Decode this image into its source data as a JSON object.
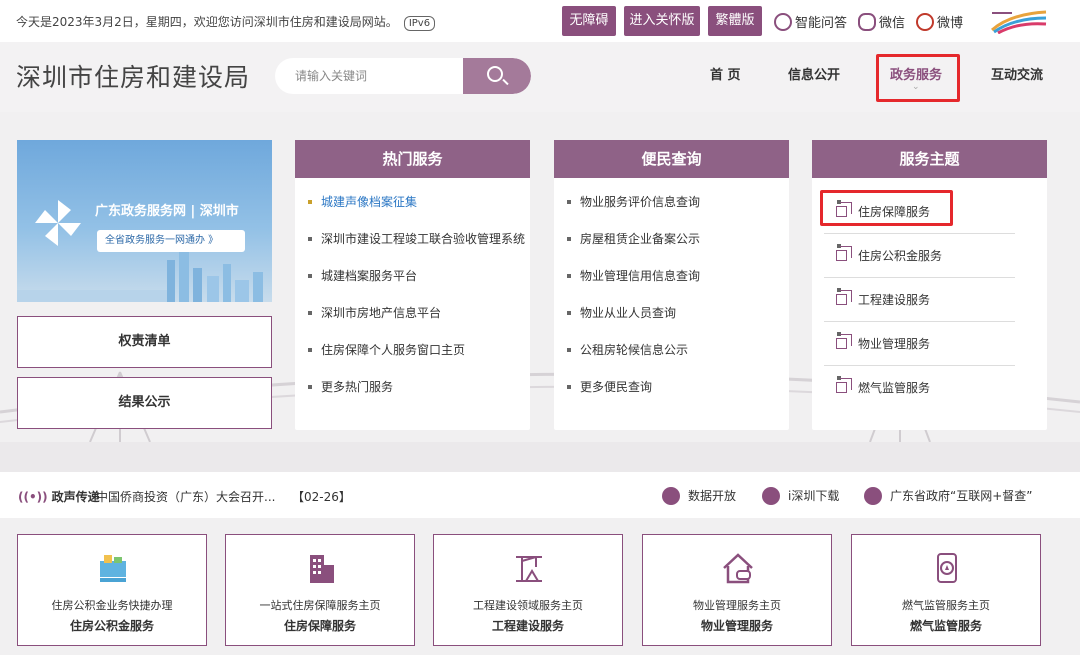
{
  "topbar": {
    "date_text": "今天是2023年3月2日，星期四，欢迎您访问深圳市住房和建设局网站。",
    "ipv6": "IPv6",
    "buttons": [
      "无障碍",
      "进入关怀版",
      "繁體版"
    ],
    "links": [
      "智能问答",
      "微信",
      "微博"
    ]
  },
  "header": {
    "site_title": "深圳市住房和建设局",
    "search_placeholder": "请输入关键词",
    "nav": [
      "首 页",
      "信息公开",
      "政务服务",
      "互动交流"
    ],
    "active_nav": "政务服务"
  },
  "banner": {
    "title": "广东政务服务网 | 深圳市",
    "pill": "全省政务服务一网通办 》"
  },
  "side_buttons": [
    "权责清单",
    "结果公示"
  ],
  "panels": {
    "hot": {
      "title": "热门服务",
      "items": [
        "城建声像档案征集",
        "深圳市建设工程竣工联合验收管理系统",
        "城建档案服务平台",
        "深圳市房地产信息平台",
        "住房保障个人服务窗口主页",
        "更多热门服务"
      ]
    },
    "query": {
      "title": "便民查询",
      "items": [
        "物业服务评价信息查询",
        "房屋租赁企业备案公示",
        "物业管理信用信息查询",
        "物业从业人员查询",
        "公租房轮候信息公示",
        "更多便民查询"
      ]
    },
    "themes": {
      "title": "服务主题",
      "items": [
        "住房保障服务",
        "住房公积金服务",
        "工程建设服务",
        "物业管理服务",
        "燃气监管服务"
      ]
    }
  },
  "newsbar": {
    "label": "政声传递",
    "text": "中国侨商投资（广东）大会召开...",
    "date": "【02-26】",
    "links": [
      "数据开放",
      "i深圳下载",
      "广东省政府“互联网+督查”"
    ]
  },
  "cards": [
    {
      "line1": "住房公积金业务快捷办理",
      "line2": "住房公积金服务"
    },
    {
      "line1": "一站式住房保障服务主页",
      "line2": "住房保障服务"
    },
    {
      "line1": "工程建设领域服务主页",
      "line2": "工程建设服务"
    },
    {
      "line1": "物业管理服务主页",
      "line2": "物业管理服务"
    },
    {
      "line1": "燃气监管服务主页",
      "line2": "燃气监管服务"
    }
  ],
  "colors": {
    "brand": "#8a4f7d",
    "panel_header": "#8f6287",
    "highlight_box": "#e5282c",
    "hot_link": "#2b77c4"
  }
}
